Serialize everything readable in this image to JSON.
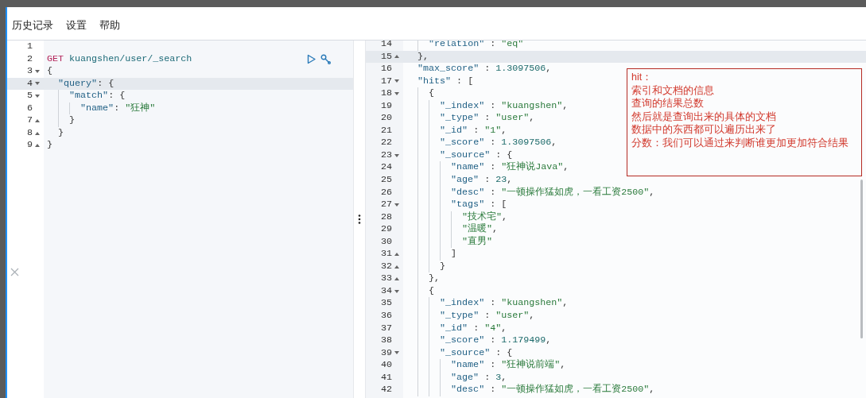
{
  "menu": [
    {
      "label": "历史记录"
    },
    {
      "label": "设置"
    },
    {
      "label": "帮助"
    }
  ],
  "request_editor": {
    "lines": [
      {
        "number": "1",
        "active": false
      },
      {
        "number": "2",
        "active": false,
        "tokens": [
          {
            "kind": "method",
            "text": "GET"
          },
          {
            "kind": "url",
            "text": "kuangshen/user/_search"
          }
        ]
      },
      {
        "number": "3",
        "active": false,
        "expanded": true,
        "tokens": [
          {
            "kind": "punct",
            "text": "{"
          }
        ]
      },
      {
        "number": "4",
        "active": true,
        "expanded": true,
        "tokens": [
          {
            "kind": "key",
            "text": "  \"query\""
          },
          {
            "kind": "punct",
            "text": ": {"
          }
        ]
      },
      {
        "number": "5",
        "active": false,
        "expanded": true,
        "tokens": [
          {
            "kind": "key",
            "text": "    \"match\""
          },
          {
            "kind": "punct",
            "text": ": {"
          }
        ]
      },
      {
        "number": "6",
        "active": false,
        "tokens": [
          {
            "kind": "key",
            "text": "      \"name\""
          },
          {
            "kind": "punct",
            "text": ": "
          },
          {
            "kind": "string",
            "text": "\"狂神\""
          }
        ]
      },
      {
        "number": "7",
        "active": false,
        "expanded": false,
        "tokens": [
          {
            "kind": "punct",
            "text": "    }"
          }
        ]
      },
      {
        "number": "8",
        "active": false,
        "expanded": false,
        "tokens": [
          {
            "kind": "punct",
            "text": "  }"
          }
        ]
      },
      {
        "number": "9",
        "active": false,
        "expanded": false,
        "tokens": [
          {
            "kind": "punct",
            "text": "}"
          }
        ]
      }
    ]
  },
  "response_viewer": {
    "lines": [
      {
        "number": "14",
        "active": false,
        "tokens": [
          {
            "kind": "key",
            "text": "    \"relation\""
          },
          {
            "kind": "punct",
            "text": " : "
          },
          {
            "kind": "string",
            "text": "\"eq\""
          }
        ]
      },
      {
        "number": "15",
        "active": true,
        "expanded": false,
        "tokens": [
          {
            "kind": "punct",
            "text": "  },"
          }
        ]
      },
      {
        "number": "16",
        "active": false,
        "tokens": [
          {
            "kind": "key",
            "text": "  \"max_score\""
          },
          {
            "kind": "punct",
            "text": " : "
          },
          {
            "kind": "number",
            "text": "1.3097506"
          },
          {
            "kind": "punct",
            "text": ","
          }
        ]
      },
      {
        "number": "17",
        "active": false,
        "expanded": true,
        "tokens": [
          {
            "kind": "key",
            "text": "  \"hits\""
          },
          {
            "kind": "punct",
            "text": " : ["
          }
        ]
      },
      {
        "number": "18",
        "active": false,
        "expanded": true,
        "tokens": [
          {
            "kind": "punct",
            "text": "    {"
          }
        ]
      },
      {
        "number": "19",
        "active": false,
        "tokens": [
          {
            "kind": "key",
            "text": "      \"_index\""
          },
          {
            "kind": "punct",
            "text": " : "
          },
          {
            "kind": "string",
            "text": "\"kuangshen\""
          },
          {
            "kind": "punct",
            "text": ","
          }
        ]
      },
      {
        "number": "20",
        "active": false,
        "tokens": [
          {
            "kind": "key",
            "text": "      \"_type\""
          },
          {
            "kind": "punct",
            "text": " : "
          },
          {
            "kind": "string",
            "text": "\"user\""
          },
          {
            "kind": "punct",
            "text": ","
          }
        ]
      },
      {
        "number": "21",
        "active": false,
        "tokens": [
          {
            "kind": "key",
            "text": "      \"_id\""
          },
          {
            "kind": "punct",
            "text": " : "
          },
          {
            "kind": "string",
            "text": "\"1\""
          },
          {
            "kind": "punct",
            "text": ","
          }
        ]
      },
      {
        "number": "22",
        "active": false,
        "tokens": [
          {
            "kind": "key",
            "text": "      \"_score\""
          },
          {
            "kind": "punct",
            "text": " : "
          },
          {
            "kind": "number",
            "text": "1.3097506"
          },
          {
            "kind": "punct",
            "text": ","
          }
        ]
      },
      {
        "number": "23",
        "active": false,
        "expanded": true,
        "tokens": [
          {
            "kind": "key",
            "text": "      \"_source\""
          },
          {
            "kind": "punct",
            "text": " : {"
          }
        ]
      },
      {
        "number": "24",
        "active": false,
        "tokens": [
          {
            "kind": "key",
            "text": "        \"name\""
          },
          {
            "kind": "punct",
            "text": " : "
          },
          {
            "kind": "string",
            "text": "\"狂神说Java\""
          },
          {
            "kind": "punct",
            "text": ","
          }
        ]
      },
      {
        "number": "25",
        "active": false,
        "tokens": [
          {
            "kind": "key",
            "text": "        \"age\""
          },
          {
            "kind": "punct",
            "text": " : "
          },
          {
            "kind": "number",
            "text": "23"
          },
          {
            "kind": "punct",
            "text": ","
          }
        ]
      },
      {
        "number": "26",
        "active": false,
        "tokens": [
          {
            "kind": "key",
            "text": "        \"desc\""
          },
          {
            "kind": "punct",
            "text": " : "
          },
          {
            "kind": "string",
            "text": "\"一顿操作猛如虎，一看工资2500\""
          },
          {
            "kind": "punct",
            "text": ","
          }
        ]
      },
      {
        "number": "27",
        "active": false,
        "expanded": true,
        "tokens": [
          {
            "kind": "key",
            "text": "        \"tags\""
          },
          {
            "kind": "punct",
            "text": " : ["
          }
        ]
      },
      {
        "number": "28",
        "active": false,
        "tokens": [
          {
            "kind": "string",
            "text": "          \"技术宅\""
          },
          {
            "kind": "punct",
            "text": ","
          }
        ]
      },
      {
        "number": "29",
        "active": false,
        "tokens": [
          {
            "kind": "string",
            "text": "          \"温暖\""
          },
          {
            "kind": "punct",
            "text": ","
          }
        ]
      },
      {
        "number": "30",
        "active": false,
        "tokens": [
          {
            "kind": "string",
            "text": "          \"直男\""
          }
        ]
      },
      {
        "number": "31",
        "active": false,
        "expanded": false,
        "tokens": [
          {
            "kind": "punct",
            "text": "        ]"
          }
        ]
      },
      {
        "number": "32",
        "active": false,
        "expanded": false,
        "tokens": [
          {
            "kind": "punct",
            "text": "      }"
          }
        ]
      },
      {
        "number": "33",
        "active": false,
        "expanded": false,
        "tokens": [
          {
            "kind": "punct",
            "text": "    },"
          }
        ]
      },
      {
        "number": "34",
        "active": false,
        "expanded": true,
        "tokens": [
          {
            "kind": "punct",
            "text": "    {"
          }
        ]
      },
      {
        "number": "35",
        "active": false,
        "tokens": [
          {
            "kind": "key",
            "text": "      \"_index\""
          },
          {
            "kind": "punct",
            "text": " : "
          },
          {
            "kind": "string",
            "text": "\"kuangshen\""
          },
          {
            "kind": "punct",
            "text": ","
          }
        ]
      },
      {
        "number": "36",
        "active": false,
        "tokens": [
          {
            "kind": "key",
            "text": "      \"_type\""
          },
          {
            "kind": "punct",
            "text": " : "
          },
          {
            "kind": "string",
            "text": "\"user\""
          },
          {
            "kind": "punct",
            "text": ","
          }
        ]
      },
      {
        "number": "37",
        "active": false,
        "tokens": [
          {
            "kind": "key",
            "text": "      \"_id\""
          },
          {
            "kind": "punct",
            "text": " : "
          },
          {
            "kind": "string",
            "text": "\"4\""
          },
          {
            "kind": "punct",
            "text": ","
          }
        ]
      },
      {
        "number": "38",
        "active": false,
        "tokens": [
          {
            "kind": "key",
            "text": "      \"_score\""
          },
          {
            "kind": "punct",
            "text": " : "
          },
          {
            "kind": "number",
            "text": "1.179499"
          },
          {
            "kind": "punct",
            "text": ","
          }
        ]
      },
      {
        "number": "39",
        "active": false,
        "expanded": true,
        "tokens": [
          {
            "kind": "key",
            "text": "      \"_source\""
          },
          {
            "kind": "punct",
            "text": " : {"
          }
        ]
      },
      {
        "number": "40",
        "active": false,
        "tokens": [
          {
            "kind": "key",
            "text": "        \"name\""
          },
          {
            "kind": "punct",
            "text": " : "
          },
          {
            "kind": "string",
            "text": "\"狂神说前端\""
          },
          {
            "kind": "punct",
            "text": ","
          }
        ]
      },
      {
        "number": "41",
        "active": false,
        "tokens": [
          {
            "kind": "key",
            "text": "        \"age\""
          },
          {
            "kind": "punct",
            "text": " : "
          },
          {
            "kind": "number",
            "text": "3"
          },
          {
            "kind": "punct",
            "text": ","
          }
        ]
      },
      {
        "number": "42",
        "active": false,
        "tokens": [
          {
            "kind": "key",
            "text": "        \"desc\""
          },
          {
            "kind": "punct",
            "text": " : "
          },
          {
            "kind": "string",
            "text": "\"一顿操作猛如虎，一看工资2500\""
          },
          {
            "kind": "punct",
            "text": ","
          }
        ]
      }
    ]
  },
  "annotation": {
    "lines": [
      "hit：",
      "索引和文档的信息",
      "查询的结果总数",
      "然后就是查询出来的具体的文档",
      "数据中的东西都可以遍历出来了",
      "分数：我们可以通过来判断谁更加更加符合结果"
    ]
  }
}
